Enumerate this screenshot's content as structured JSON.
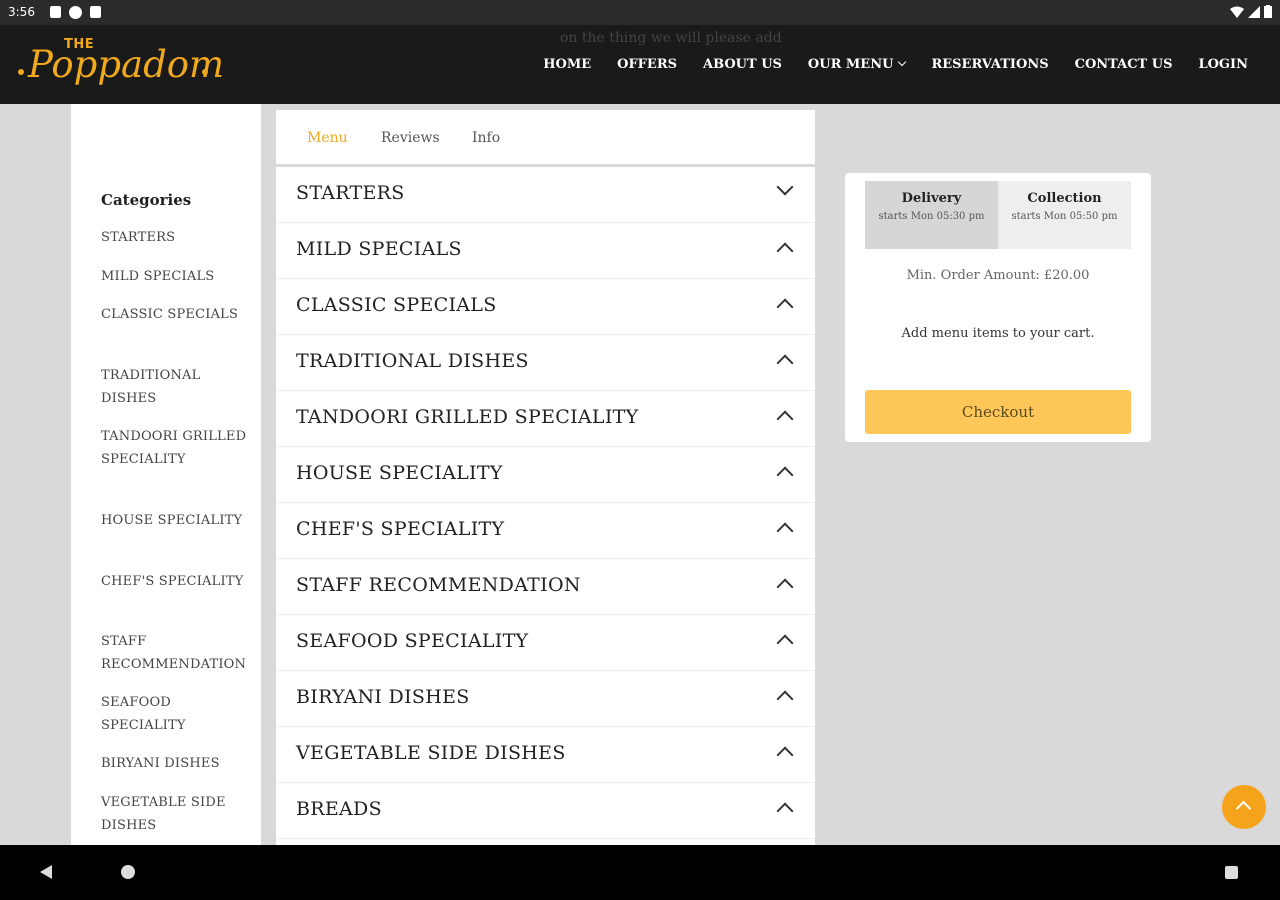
{
  "status_bar": {
    "time": "3:56"
  },
  "header": {
    "faded_text": "on the thing we will please add",
    "logo": {
      "the": "THE",
      "name": "Poppadom"
    },
    "nav": [
      {
        "label": "HOME"
      },
      {
        "label": "OFFERS"
      },
      {
        "label": "ABOUT US"
      },
      {
        "label": "OUR MENU"
      },
      {
        "label": "RESERVATIONS"
      },
      {
        "label": "CONTACT US"
      },
      {
        "label": "LOGIN"
      }
    ]
  },
  "sidebar": {
    "title": "Categories",
    "items": [
      "STARTERS",
      "MILD SPECIALS",
      "CLASSIC SPECIALS",
      "TRADITIONAL DISHES",
      "TANDOORI GRILLED SPECIALITY",
      "HOUSE SPECIALITY",
      "CHEF'S SPECIALITY",
      "STAFF RECOMMENDATION",
      "SEAFOOD SPECIALITY",
      "BIRYANI DISHES",
      "VEGETABLE SIDE DISHES"
    ]
  },
  "tabs": [
    {
      "label": "Menu",
      "active": true
    },
    {
      "label": "Reviews",
      "active": false
    },
    {
      "label": "Info",
      "active": false
    }
  ],
  "menu_sections": [
    {
      "label": "STARTERS",
      "chevron": "chevron-down-icon"
    },
    {
      "label": "MILD SPECIALS",
      "chevron": "chevron-up-icon"
    },
    {
      "label": "CLASSIC SPECIALS",
      "chevron": "chevron-up-icon"
    },
    {
      "label": "TRADITIONAL DISHES",
      "chevron": "chevron-up-icon"
    },
    {
      "label": "TANDOORI GRILLED SPECIALITY",
      "chevron": "chevron-up-icon"
    },
    {
      "label": "HOUSE SPECIALITY",
      "chevron": "chevron-up-icon"
    },
    {
      "label": "CHEF'S SPECIALITY",
      "chevron": "chevron-up-icon"
    },
    {
      "label": "STAFF RECOMMENDATION",
      "chevron": "chevron-up-icon"
    },
    {
      "label": "SEAFOOD SPECIALITY",
      "chevron": "chevron-up-icon"
    },
    {
      "label": "BIRYANI DISHES",
      "chevron": "chevron-up-icon"
    },
    {
      "label": "VEGETABLE SIDE DISHES",
      "chevron": "chevron-up-icon"
    },
    {
      "label": "BREADS",
      "chevron": "chevron-up-icon"
    }
  ],
  "cart": {
    "delivery": {
      "title": "Delivery",
      "subtitle": "starts Mon 05:30 pm"
    },
    "collection": {
      "title": "Collection",
      "subtitle": "starts Mon 05:50 pm"
    },
    "min_order": "Min. Order Amount: £20.00",
    "empty_message": "Add menu items to your cart.",
    "checkout_label": "Checkout"
  },
  "colors": {
    "accent": "#f0a81c",
    "checkout_button": "#ffc658",
    "header_bg": "#1a1a1a",
    "page_bg": "#d9d9d9"
  }
}
